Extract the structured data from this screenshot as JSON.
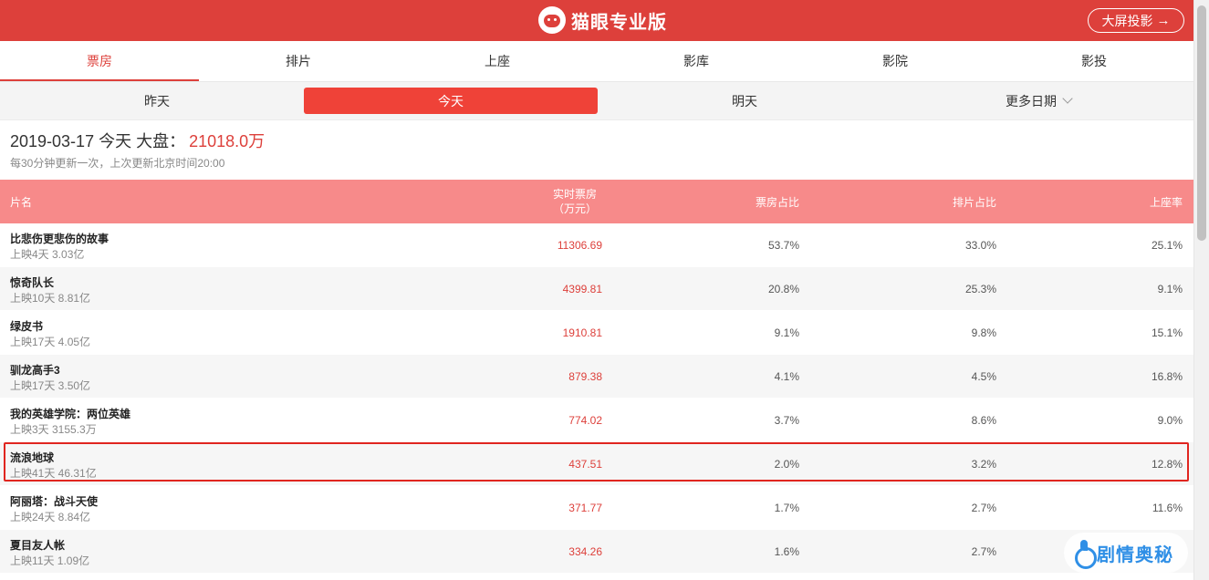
{
  "header": {
    "brand": "猫眼专业版",
    "screen_button": "大屏投影",
    "arrow": "→",
    "color": "#dd403b"
  },
  "nav": {
    "tabs": [
      {
        "label": "票房",
        "active": true
      },
      {
        "label": "排片",
        "active": false
      },
      {
        "label": "上座",
        "active": false
      },
      {
        "label": "影库",
        "active": false
      },
      {
        "label": "影院",
        "active": false
      },
      {
        "label": "影投",
        "active": false
      }
    ]
  },
  "datebar": {
    "items": [
      {
        "label": "昨天",
        "active": false
      },
      {
        "label": "今天",
        "active": true
      },
      {
        "label": "明天",
        "active": false
      },
      {
        "label": "更多日期",
        "active": false
      }
    ]
  },
  "summary": {
    "date_text": "2019-03-17 今天 大盘：",
    "total": "21018.0万",
    "update_note": "每30分钟更新一次，上次更新北京时间20:00"
  },
  "table": {
    "headers": {
      "name": "片名",
      "realtime_line1": "实时票房",
      "realtime_line2": "（万元）",
      "box_share": "票房占比",
      "schedule_share": "排片占比",
      "seat_rate": "上座率"
    },
    "rows": [
      {
        "name": "比悲伤更悲伤的故事",
        "info": "上映4天 3.03亿",
        "realtime": "11306.69",
        "box_share": "53.7%",
        "schedule_share": "33.0%",
        "seat_rate": "25.1%"
      },
      {
        "name": "惊奇队长",
        "info": "上映10天 8.81亿",
        "realtime": "4399.81",
        "box_share": "20.8%",
        "schedule_share": "25.3%",
        "seat_rate": "9.1%"
      },
      {
        "name": "绿皮书",
        "info": "上映17天 4.05亿",
        "realtime": "1910.81",
        "box_share": "9.1%",
        "schedule_share": "9.8%",
        "seat_rate": "15.1%"
      },
      {
        "name": "驯龙高手3",
        "info": "上映17天 3.50亿",
        "realtime": "879.38",
        "box_share": "4.1%",
        "schedule_share": "4.5%",
        "seat_rate": "16.8%"
      },
      {
        "name": "我的英雄学院：两位英雄",
        "info": "上映3天 3155.3万",
        "realtime": "774.02",
        "box_share": "3.7%",
        "schedule_share": "8.6%",
        "seat_rate": "9.0%"
      },
      {
        "name": "流浪地球",
        "info": "上映41天 46.31亿",
        "realtime": "437.51",
        "box_share": "2.0%",
        "schedule_share": "3.2%",
        "seat_rate": "12.8%"
      },
      {
        "name": "阿丽塔：战斗天使",
        "info": "上映24天 8.84亿",
        "realtime": "371.77",
        "box_share": "1.7%",
        "schedule_share": "2.7%",
        "seat_rate": "11.6%"
      },
      {
        "name": "夏目友人帐",
        "info": "上映11天 1.09亿",
        "realtime": "334.26",
        "box_share": "1.6%",
        "schedule_share": "2.7%",
        "seat_rate": "—"
      }
    ]
  },
  "watermark": {
    "text": "剧情奥秘"
  }
}
